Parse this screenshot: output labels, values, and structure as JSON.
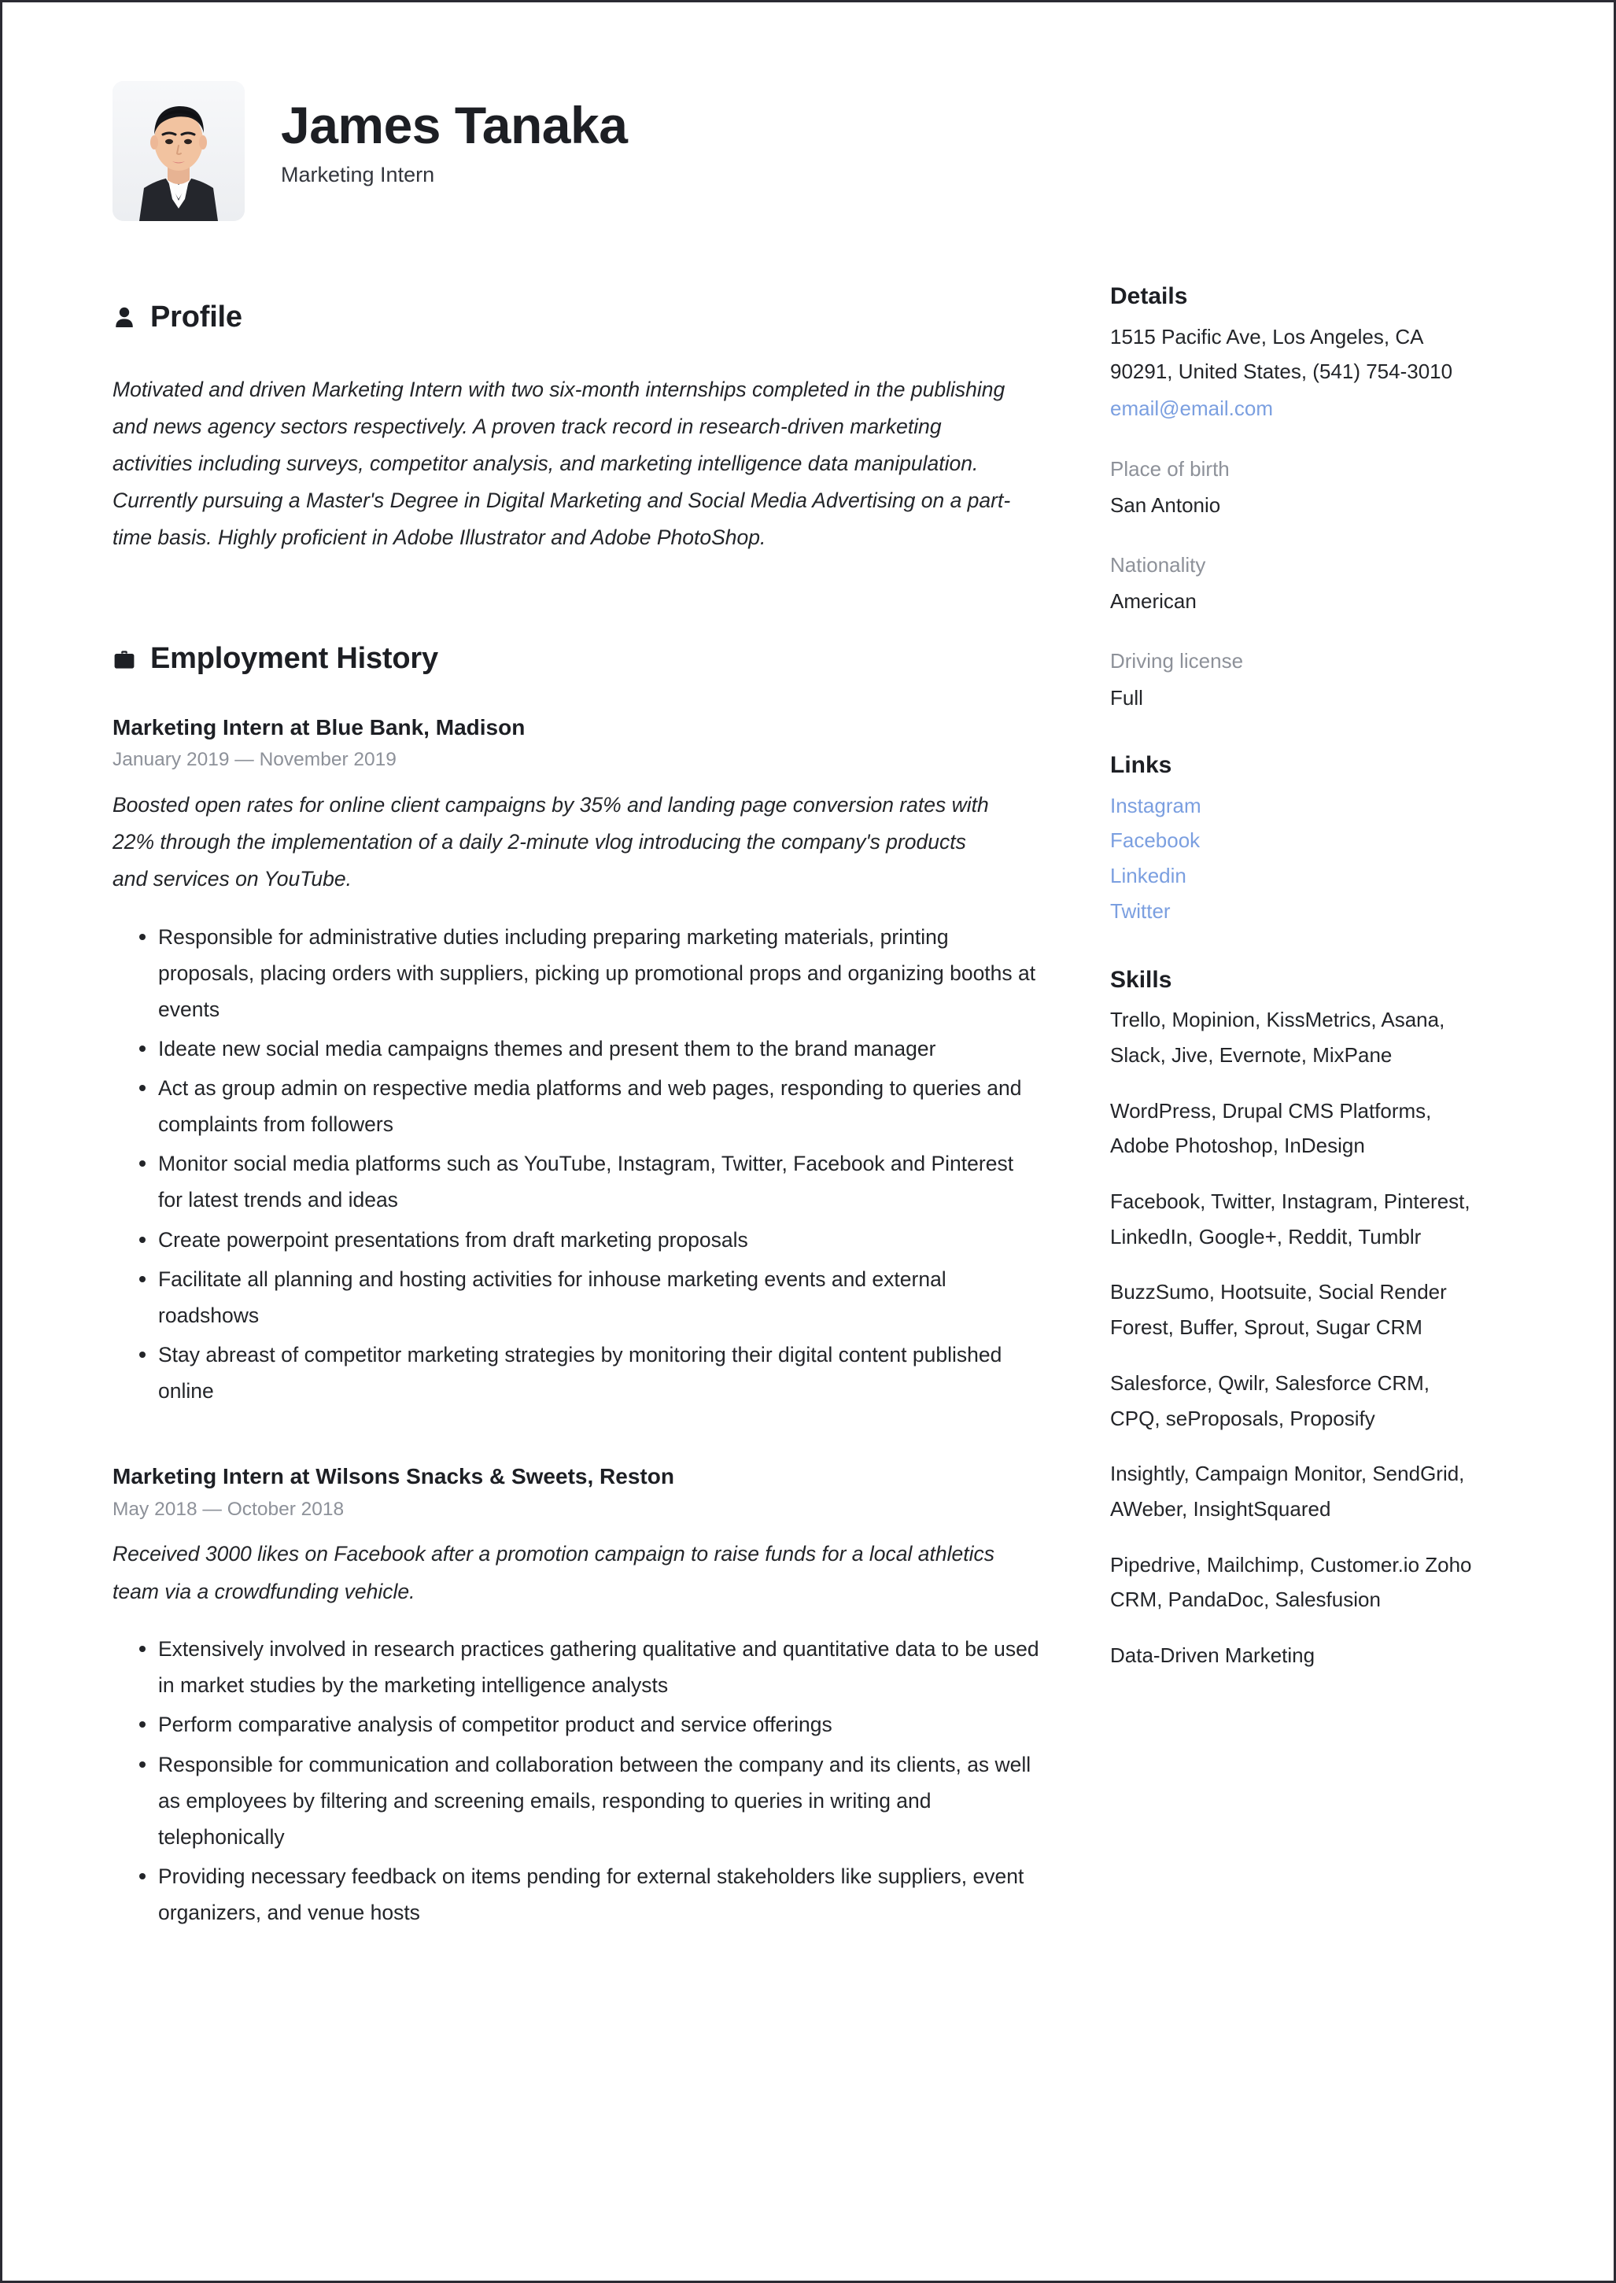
{
  "header": {
    "name": "James Tanaka",
    "job_title": "Marketing Intern",
    "photo_alt": "portrait-photo"
  },
  "profile": {
    "heading": "Profile",
    "icon": "person-icon",
    "text": "Motivated and driven Marketing Intern with two six-month internships completed in the publishing and news agency sectors respectively. A proven track record in research-driven marketing activities including surveys, competitor analysis, and marketing intelligence data manipulation. Currently pursuing a Master's Degree in Digital Marketing and Social Media Advertising on a part-time basis. Highly proficient in Adobe Illustrator and Adobe PhotoShop."
  },
  "employment": {
    "heading": "Employment History",
    "icon": "briefcase-icon",
    "jobs": [
      {
        "title": "Marketing Intern at  Blue Bank, Madison",
        "dates": "January 2019 — November 2019",
        "summary": "Boosted open rates for online client campaigns by 35% and landing page conversion rates with 22% through the implementation of a daily 2-minute vlog introducing the company's products and services on YouTube.",
        "bullets": [
          "Responsible for administrative duties including preparing marketing materials, printing proposals, placing orders with suppliers, picking up promotional props and organizing booths at events",
          "Ideate new social media campaigns themes and present them to the brand manager",
          "Act as group admin on respective media platforms and web pages, responding to queries and complaints from followers",
          "Monitor social media platforms such as YouTube, Instagram, Twitter, Facebook and Pinterest for latest trends and ideas",
          "Create powerpoint presentations from draft marketing proposals",
          "Facilitate all planning and hosting activities for inhouse marketing events and external roadshows",
          "Stay abreast of competitor marketing strategies by monitoring their digital content published online"
        ]
      },
      {
        "title": "Marketing Intern at  Wilsons Snacks & Sweets, Reston",
        "dates": "May 2018 — October 2018",
        "summary": "Received 3000 likes on Facebook after a promotion campaign to raise funds for a local athletics team via a crowdfunding vehicle.",
        "bullets": [
          "Extensively involved in research practices gathering qualitative and quantitative data to be used in market studies by the marketing intelligence analysts",
          "Perform comparative analysis of competitor product and service offerings",
          "Responsible for communication and collaboration between the company and its clients, as well as employees by filtering and screening emails, responding to queries in writing and telephonically",
          "Providing necessary feedback on items pending for external stakeholders like suppliers, event organizers, and venue hosts"
        ]
      }
    ]
  },
  "details": {
    "heading": "Details",
    "address": "1515 Pacific Ave, Los Angeles, CA 90291, United States, (541) 754-3010",
    "email": "email@email.com",
    "fields": [
      {
        "label": "Place of birth",
        "value": "San Antonio"
      },
      {
        "label": "Nationality",
        "value": "American"
      },
      {
        "label": "Driving license",
        "value": "Full"
      }
    ]
  },
  "links": {
    "heading": "Links",
    "items": [
      {
        "label": "Instagram"
      },
      {
        "label": "Facebook"
      },
      {
        "label": "Linkedin"
      },
      {
        "label": "Twitter"
      }
    ]
  },
  "skills": {
    "heading": "Skills",
    "groups": [
      "Trello, Mopinion, KissMetrics, Asana, Slack, Jive, Evernote, MixPane",
      "WordPress, Drupal CMS Platforms, Adobe Photoshop, InDesign",
      "Facebook, Twitter, Instagram, Pinterest, LinkedIn, Google+, Reddit, Tumblr",
      "BuzzSumo, Hootsuite, Social Render Forest, Buffer, Sprout, Sugar CRM",
      "Salesforce, Qwilr, Salesforce CRM, CPQ, seProposals, Proposify",
      "Insightly, Campaign Monitor, SendGrid, AWeber, InsightSquared",
      "Pipedrive, Mailchimp, Customer.io Zoho CRM, PandaDoc, Salesfusion",
      "Data-Driven Marketing"
    ]
  },
  "colors": {
    "link": "#7b9fe0",
    "text": "#232529",
    "muted": "#8d9199",
    "heading": "#1d1f24",
    "border": "#2b2b33"
  }
}
